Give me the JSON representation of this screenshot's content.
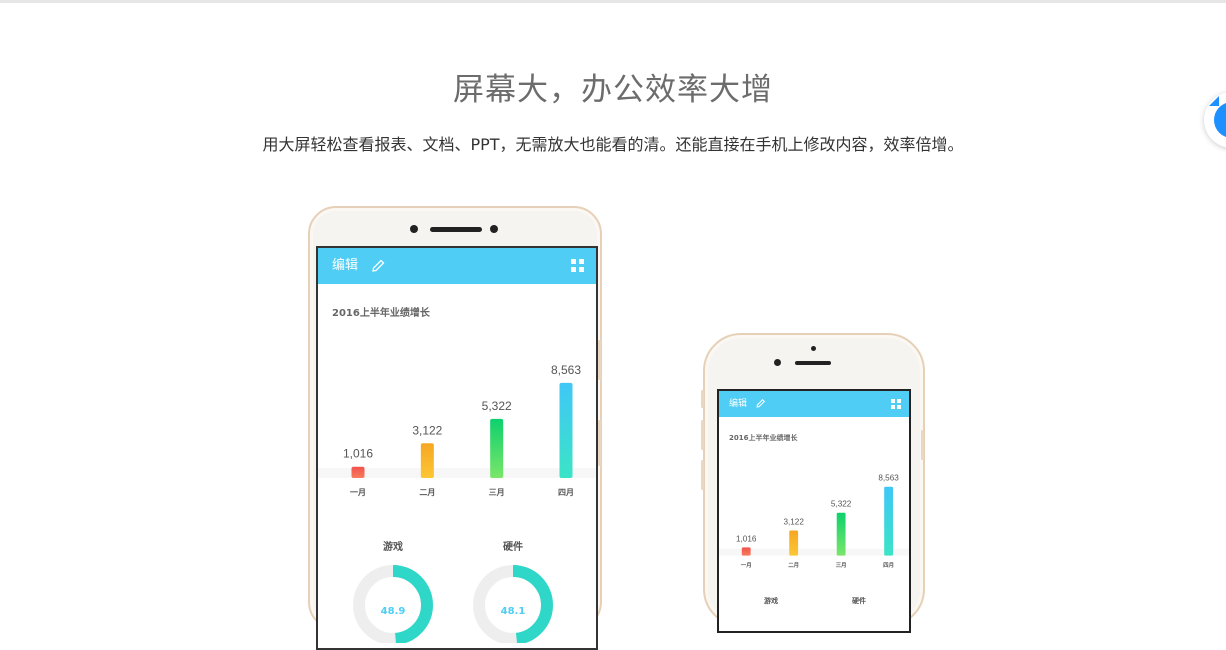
{
  "hero": {
    "title": "屏幕大，办公效率大增",
    "subtitle": "用大屏轻松查看报表、文档、PPT，无需放大也能看的清。还能直接在手机上修改内容，效率倍增。"
  },
  "app": {
    "edit_label": "编辑",
    "pencil_icon": "pencil-icon",
    "grid_icon": "grid-icon",
    "chart_title": "2016上半年业绩增长",
    "donut_labels": [
      "游戏",
      "硬件"
    ],
    "donut_values": [
      "48.9",
      "48.1"
    ]
  },
  "chart_data": {
    "type": "bar",
    "title": "2016上半年业绩增长",
    "categories": [
      "一月",
      "二月",
      "三月",
      "四月"
    ],
    "values": [
      1016,
      3122,
      5322,
      8563
    ],
    "value_labels": [
      "1,016",
      "3,122",
      "5,322",
      "8,563"
    ],
    "ylim": [
      0,
      9000
    ],
    "colors": [
      [
        "#f1524b",
        "#f87d5e"
      ],
      [
        "#f6a723",
        "#fcc635"
      ],
      [
        "#0dd16d",
        "#7ae66a"
      ],
      [
        "#40c7f7",
        "#3be4c6"
      ]
    ]
  },
  "colors": {
    "accent": "#4fcdf5",
    "frame": "#e6d1b8"
  }
}
